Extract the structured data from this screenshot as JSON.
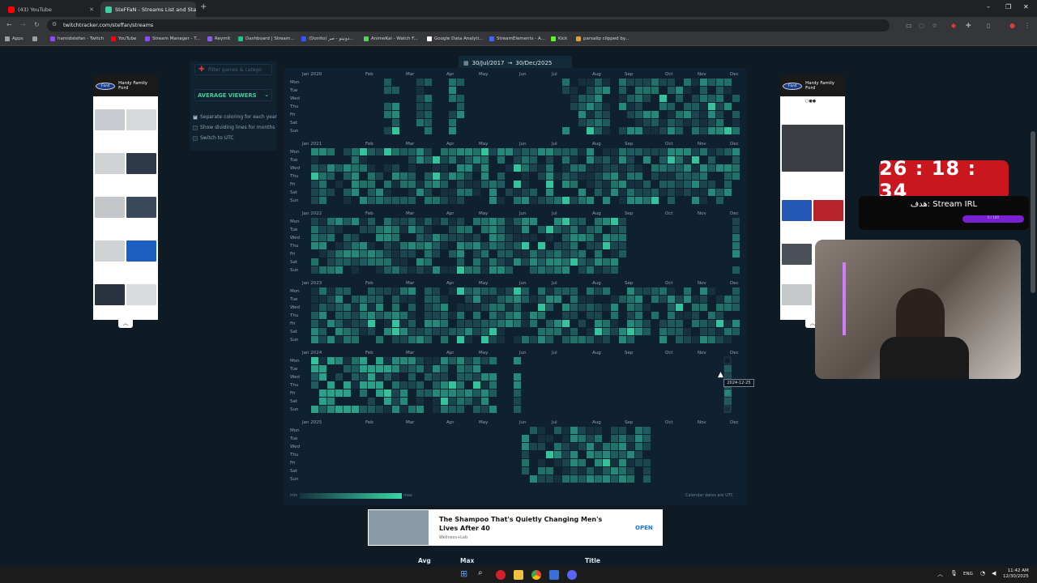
{
  "browser": {
    "tabs": [
      {
        "label": "(43) YouTube",
        "color": "#ff0000",
        "active": false
      },
      {
        "label": "SteFFaN - Streams List and Stat",
        "color": "#3ecf9f",
        "active": true
      }
    ],
    "url": "twitchtracker.com/steffan/streams",
    "bookmarks": [
      {
        "label": "Apps",
        "color": "#9aa0a6"
      },
      {
        "label": "hamidstefan - Twitch",
        "color": "#9146ff"
      },
      {
        "label": "YouTube",
        "color": "#ff0000"
      },
      {
        "label": "Stream Manager - T...",
        "color": "#9146ff"
      },
      {
        "label": "Reymit",
        "color": "#8a5cf6"
      },
      {
        "label": "Dashboard | Stream...",
        "color": "#26c281"
      },
      {
        "label": "(Donito) دونیتو - صر...",
        "color": "#3355ff"
      },
      {
        "label": "AnimeKai - Watch F...",
        "color": "#56d364"
      },
      {
        "label": "Google Data Analyti...",
        "color": "#ffffff"
      },
      {
        "label": "StreamElements - A...",
        "color": "#2f6bff"
      },
      {
        "label": "Kick",
        "color": "#53fc18"
      },
      {
        "label": "parsalip clipped by...",
        "color": "#e0a030"
      }
    ]
  },
  "sidebar": {
    "filter_placeholder": "Filter games & catego",
    "metric_select": "AVERAGE VIEWERS",
    "options": [
      {
        "label": "Separate coloring for each year",
        "checked": true
      },
      {
        "label": "Show dividing lines for months",
        "checked": false
      },
      {
        "label": "Switch to UTC",
        "checked": false
      }
    ]
  },
  "calendar": {
    "date_range_from": "30/Jul/2017",
    "date_range_arrow": "→",
    "date_range_to": "30/Dec/2025",
    "weekdays": [
      "Mon",
      "Tue",
      "Wed",
      "Thu",
      "Fri",
      "Sat",
      "Sun"
    ],
    "months": [
      "Feb",
      "Mar",
      "Apr",
      "May",
      "Jun",
      "Jul",
      "Aug",
      "Sep",
      "Oct",
      "Nov",
      "Dec"
    ],
    "years": [
      "Jan 2020",
      "Jan 2021",
      "Jan 2022",
      "Jan 2023",
      "Jan 2024",
      "Jan 2025"
    ],
    "tooltip": "2024-12-25",
    "legend_min": "min",
    "legend_max": "max",
    "note": "Calendar dates are UTC"
  },
  "ads": {
    "left_brand": "Hardy Family Ford",
    "right_brand": "Hardy Family Ford",
    "bottom_title": "The Shampoo That's Quietly Changing Men's Lives After 40",
    "bottom_brand": "Wellness+Lab",
    "bottom_cta": "OPEN"
  },
  "table_headers": {
    "avg": "Avg",
    "max": "Max",
    "title": "Title"
  },
  "overlay": {
    "timer": "26 : 18 : 34",
    "goal": "هدف: Stream IRL",
    "goal_bar": "0 / 100"
  },
  "taskbar": {
    "lang": "ENG",
    "time": "11:42 AM",
    "date": "12/30/2025"
  }
}
